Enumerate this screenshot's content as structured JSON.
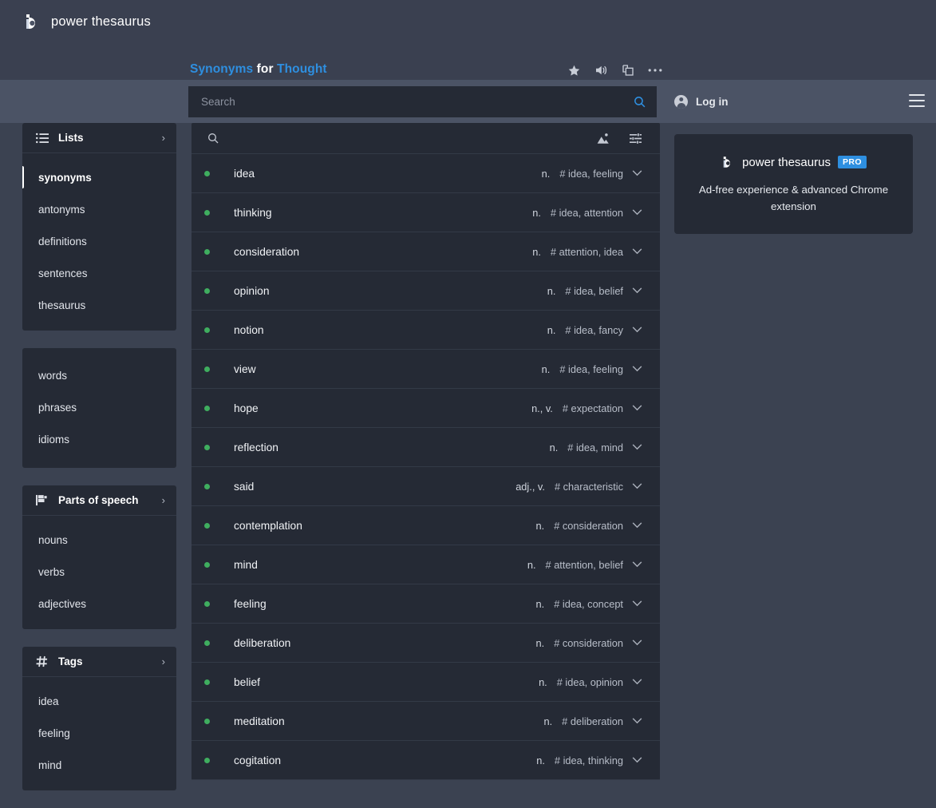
{
  "banner": {
    "title_parts": {
      "first": "Synonyms",
      "middle": "for",
      "last": "Thought"
    },
    "icons": [
      {
        "name": "star-icon",
        "label": "Favorite"
      },
      {
        "name": "speaker-icon",
        "label": "Pronounce"
      },
      {
        "name": "copy-icon",
        "label": "Copy"
      },
      {
        "name": "ellipsis-icon",
        "label": "More"
      }
    ]
  },
  "header": {
    "logo_text": "power thesaurus",
    "search": {
      "placeholder": "Search",
      "value": ""
    },
    "login_label": "Log in",
    "menu_label": "Menu"
  },
  "sidebar": {
    "sections": [
      {
        "title": "Lists",
        "icon": "list-icon",
        "arrow": "›",
        "items": [
          {
            "label": "synonyms",
            "active": true
          },
          {
            "label": "antonyms",
            "active": false
          },
          {
            "label": "definitions",
            "active": false
          },
          {
            "label": "sentences",
            "active": false
          },
          {
            "label": "thesaurus",
            "active": false
          }
        ]
      },
      {
        "title": "",
        "icon": "",
        "arrow": "",
        "items": [
          {
            "label": "words",
            "active": false
          },
          {
            "label": "phrases",
            "active": false
          },
          {
            "label": "idioms",
            "active": false
          }
        ]
      },
      {
        "title": "Parts of speech",
        "icon": "flag-icon",
        "arrow": "›",
        "items": [
          {
            "label": "nouns",
            "active": false
          },
          {
            "label": "verbs",
            "active": false
          },
          {
            "label": "adjectives",
            "active": false
          }
        ]
      },
      {
        "title": "Tags",
        "icon": "hash-icon",
        "arrow": "›",
        "items": [
          {
            "label": "idea",
            "active": false
          },
          {
            "label": "feeling",
            "active": false
          },
          {
            "label": "mind",
            "active": false
          }
        ]
      }
    ]
  },
  "list": {
    "toolbar": {
      "search_icon": "search-icon",
      "image_icon": "image-icon",
      "filter_icon": "sliders-icon"
    },
    "rows": [
      {
        "term": "idea",
        "pos": "n.",
        "tags": "# idea, feeling"
      },
      {
        "term": "thinking",
        "pos": "n.",
        "tags": "# idea, attention"
      },
      {
        "term": "consideration",
        "pos": "n.",
        "tags": "# attention, idea"
      },
      {
        "term": "opinion",
        "pos": "n.",
        "tags": "# idea, belief"
      },
      {
        "term": "notion",
        "pos": "n.",
        "tags": "# idea, fancy"
      },
      {
        "term": "view",
        "pos": "n.",
        "tags": "# idea, feeling"
      },
      {
        "term": "hope",
        "pos": "n., v.",
        "tags": "# expectation"
      },
      {
        "term": "reflection",
        "pos": "n.",
        "tags": "# idea, mind"
      },
      {
        "term": "said",
        "pos": "adj., v.",
        "tags": "# characteristic"
      },
      {
        "term": "contemplation",
        "pos": "n.",
        "tags": "# consideration"
      },
      {
        "term": "mind",
        "pos": "n.",
        "tags": "# attention, belief"
      },
      {
        "term": "feeling",
        "pos": "n.",
        "tags": "# idea, concept"
      },
      {
        "term": "deliberation",
        "pos": "n.",
        "tags": "# consideration"
      },
      {
        "term": "belief",
        "pos": "n.",
        "tags": "# idea, opinion"
      },
      {
        "term": "meditation",
        "pos": "n.",
        "tags": "# deliberation"
      },
      {
        "term": "cogitation",
        "pos": "n.",
        "tags": "# idea, thinking"
      }
    ]
  },
  "promo": {
    "brand": "power thesaurus",
    "badge": "PRO",
    "text": "Ad-free experience & advanced Chrome extension"
  },
  "colors": {
    "accent_blue": "#2e8fe0",
    "bullet_green": "#3fae5f",
    "page_bg": "#3b4251",
    "card_bg": "#252a35",
    "header_bg": "#4b5365",
    "band_bg": "#3a4050"
  }
}
